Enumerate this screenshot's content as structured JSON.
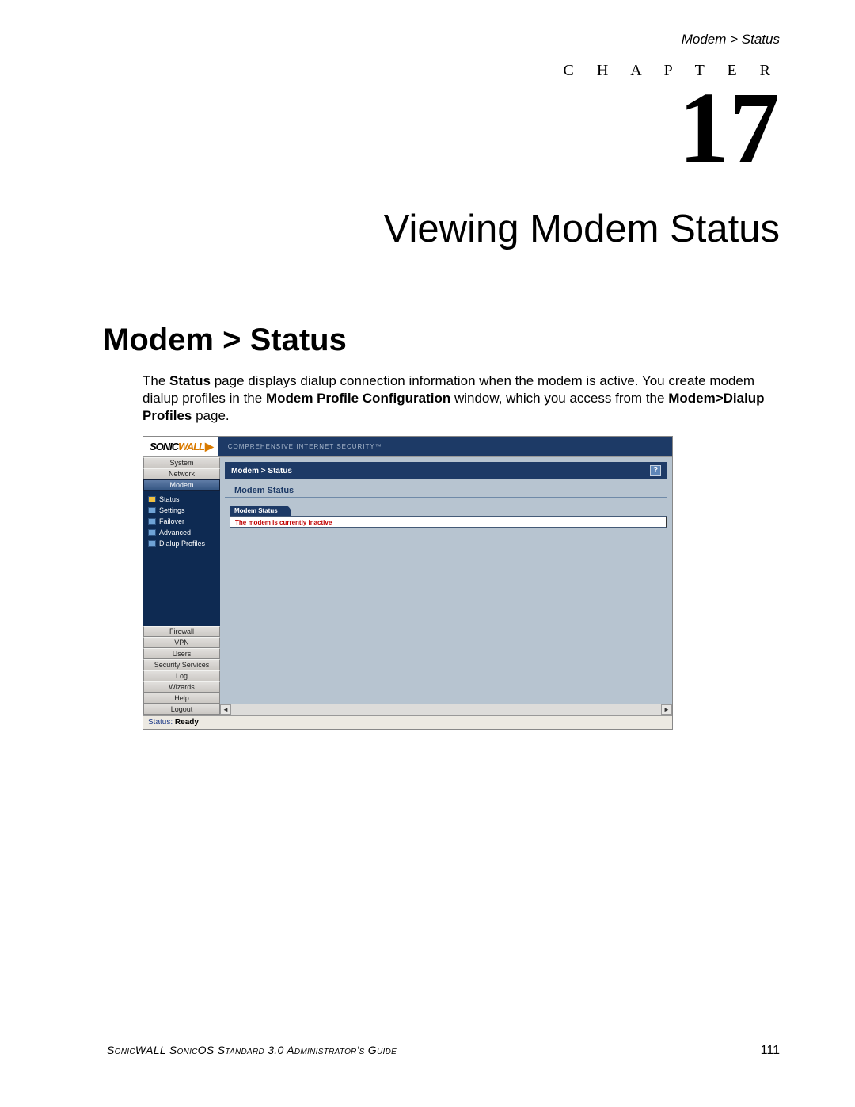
{
  "header": {
    "breadcrumb": "Modem > Status"
  },
  "chapter": {
    "label": "C H A P T E R",
    "number": "17",
    "title": "Viewing Modem Status"
  },
  "section": {
    "heading": "Modem > Status"
  },
  "paragraph": {
    "t1": "The ",
    "b1": "Status",
    "t2": " page displays dialup connection information when the modem is active. You create modem dialup profiles in the ",
    "b2": "Modem Profile Configuration",
    "t3": " window, which you access from the ",
    "b3": "Modem>Dialup Profiles",
    "t4": " page."
  },
  "screenshot": {
    "logo": {
      "part1": "SONIC",
      "part2": "WALL",
      "arrow": "▶"
    },
    "tagline": "COMPREHENSIVE INTERNET SECURITY™",
    "nav_top": [
      "System",
      "Network"
    ],
    "nav_active": "Modem",
    "subnav": [
      {
        "label": "Status",
        "active": true
      },
      {
        "label": "Settings",
        "active": false
      },
      {
        "label": "Failover",
        "active": false
      },
      {
        "label": "Advanced",
        "active": false
      },
      {
        "label": "Dialup Profiles",
        "active": false
      }
    ],
    "nav_bottom": [
      "Firewall",
      "VPN",
      "Users",
      "Security Services",
      "Log",
      "Wizards",
      "Help",
      "Logout"
    ],
    "main": {
      "breadcrumb": "Modem > Status",
      "help": "?",
      "sub_heading": "Modem Status",
      "panel_tab": "Modem Status",
      "panel_msg": "The modem is currently inactive"
    },
    "scroll": {
      "left": "◄",
      "right": "►"
    },
    "statusbar": {
      "label": "Status:",
      "value": "Ready"
    }
  },
  "footer": {
    "left": "SonicWALL SonicOS Standard 3.0 Administrator's Guide",
    "page": "111"
  }
}
